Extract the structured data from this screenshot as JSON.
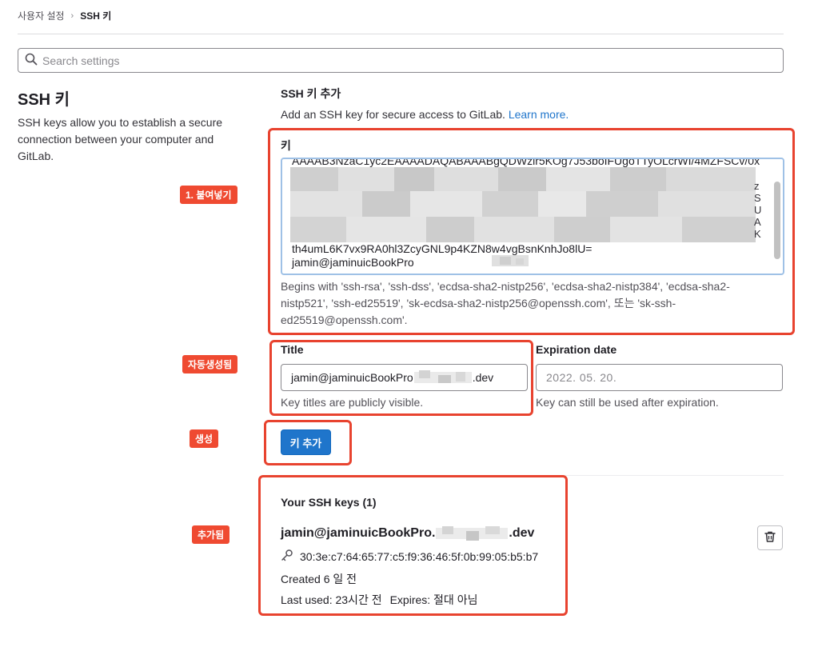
{
  "breadcrumb": {
    "parent": "사용자 설정",
    "current": "SSH 키"
  },
  "search": {
    "placeholder": "Search settings"
  },
  "left": {
    "title": "SSH 키",
    "description": "SSH keys allow you to establish a secure connection between your computer and GitLab."
  },
  "form": {
    "section_title": "SSH 키 추가",
    "section_desc": "Add an SSH key for secure access to GitLab.",
    "learn_more": "Learn more.",
    "key_label": "키",
    "key_first_line": "AAAAB3NzaC1yc2EAAAADAQABAAABgQDWzlr5KOg7J53boIFUgoTTyOLcrWI/4MZFSCv/0x",
    "key_edge_chars": "z\nS\nU\nA\nK",
    "key_last_line": "th4umL6K7vx9RA0hl3ZcyGNL9p4KZN8w4vgBsnKnhJo8lU=",
    "key_comment": "jamin@jaminuicBookPro",
    "key_help": "Begins with 'ssh-rsa', 'ssh-dss', 'ecdsa-sha2-nistp256', 'ecdsa-sha2-nistp384', 'ecdsa-sha2-nistp521', 'ssh-ed25519', 'sk-ecdsa-sha2-nistp256@openssh.com', 또는 'sk-ssh-ed25519@openssh.com'.",
    "title_label": "Title",
    "title_prefix": "jamin@jaminuicBookPro",
    "title_suffix": ".dev",
    "title_help": "Key titles are publicly visible.",
    "expiration_label": "Expiration date",
    "expiration_placeholder": "2022. 05. 20.",
    "expiration_help": "Key can still be used after expiration.",
    "submit_label": "키 추가"
  },
  "keys": {
    "heading": "Your SSH keys (1)",
    "items": [
      {
        "name_prefix": "jamin@jaminuicBookPro.",
        "name_suffix": ".dev",
        "fingerprint": "30:3e:c7:64:65:77:c5:f9:36:46:5f:0b:99:05:b5:b7",
        "created": "Created 6 일 전",
        "last_used": "Last used: 23시간 전",
        "expires": "Expires: 절대 아님"
      }
    ]
  },
  "annotations": {
    "paste": "1. 붙여넣기",
    "autogen": "자동생성됨",
    "create": "생성",
    "added": "추가됨"
  },
  "colors": {
    "accent": "#1f75cb",
    "annotation": "#ef4a31",
    "focus_border": "#9fc1e6"
  },
  "icons": [
    "search-icon",
    "key-icon",
    "trash-icon"
  ]
}
